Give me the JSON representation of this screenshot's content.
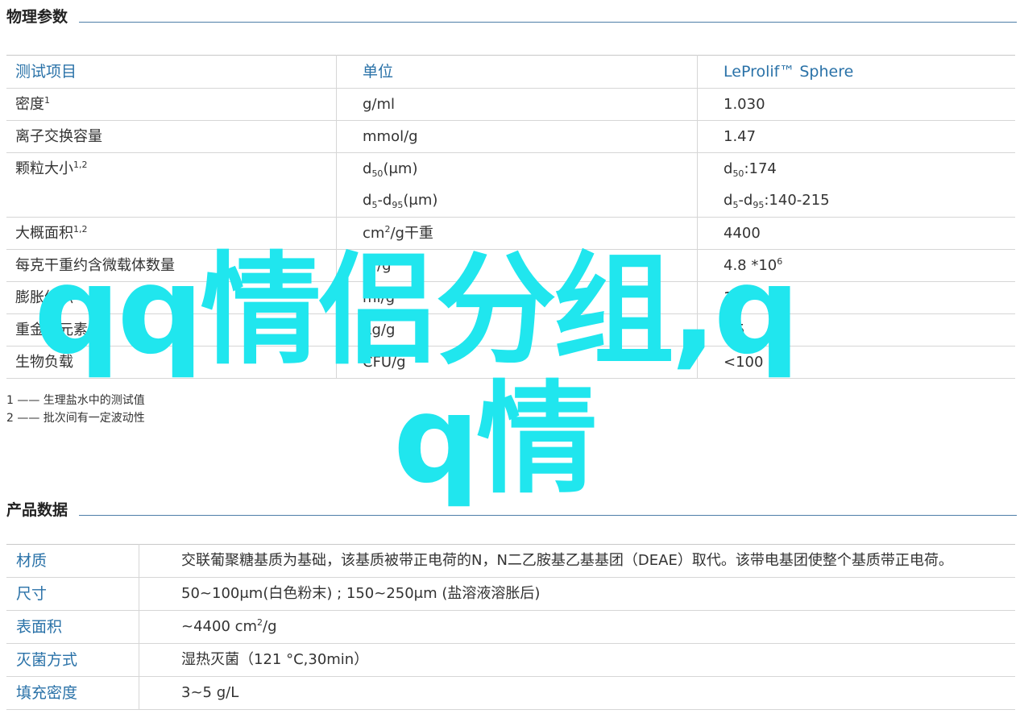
{
  "physical": {
    "title": "物理参数",
    "headers": [
      "测试项目",
      "单位",
      "LeProlif™ Sphere"
    ],
    "rows": [
      {
        "name": "密度",
        "sup": "1",
        "unit": "g/ml",
        "value": "1.030"
      },
      {
        "name": "离子交换容量",
        "sup": "",
        "unit": "mmol/g",
        "value": "1.47"
      },
      {
        "name": "颗粒大小",
        "sup": "1,2",
        "unit_a": {
          "base": "d",
          "sub": "50",
          "rest": "(μm)"
        },
        "unit_b": {
          "base": "d",
          "sub1": "5",
          "mid": "-d",
          "sub2": "95",
          "rest": "(μm)"
        },
        "value_a": {
          "base": "d",
          "sub": "50",
          "rest": ":174"
        },
        "value_b": {
          "base": "d",
          "sub1": "5",
          "mid": "-d",
          "sub2": "95",
          "rest": ":140-215"
        }
      },
      {
        "name": "大概面积",
        "sup": "1,2",
        "unit_base": "cm",
        "unit_sup": "2",
        "unit_rest": "/g干重",
        "value": "4400"
      },
      {
        "name": "每克干重约含微载体数量",
        "sup": "",
        "unit": "个/g",
        "value_base": "4.8 *10",
        "value_sup": "6"
      },
      {
        "name": "膨胀体积",
        "sup": "",
        "unit": "ml/g",
        "value": "17"
      },
      {
        "name": "重金属元素",
        "sup": "",
        "unit": "μg/g",
        "value": "<5"
      },
      {
        "name": "生物负载",
        "sup": "",
        "unit": "CFU/g",
        "value": "<100"
      }
    ],
    "footnotes": [
      "1 —— 生理盐水中的测试值",
      "2 —— 批次间有一定波动性"
    ]
  },
  "product": {
    "title": "产品数据",
    "rows": [
      {
        "key": "材质",
        "value": "交联葡聚糖基质为基础，该基质被带正电荷的N，N二乙胺基乙基基团（DEAE）取代。该带电基团使整个基质带正电荷。"
      },
      {
        "key": "尺寸",
        "value": "50~100μm(白色粉末) ; 150~250μm (盐溶液溶胀后)"
      },
      {
        "key": "表面积",
        "value_base": "~4400 cm",
        "value_sup": "2",
        "value_rest": "/g"
      },
      {
        "key": "灭菌方式",
        "value": "湿热灭菌（121 °C,30min）"
      },
      {
        "key": "填充密度",
        "value": "3~5 g/L"
      }
    ]
  },
  "watermark": {
    "line1": "qq情侣分组,q",
    "line2": "q情",
    "color": "#20e6ee"
  }
}
